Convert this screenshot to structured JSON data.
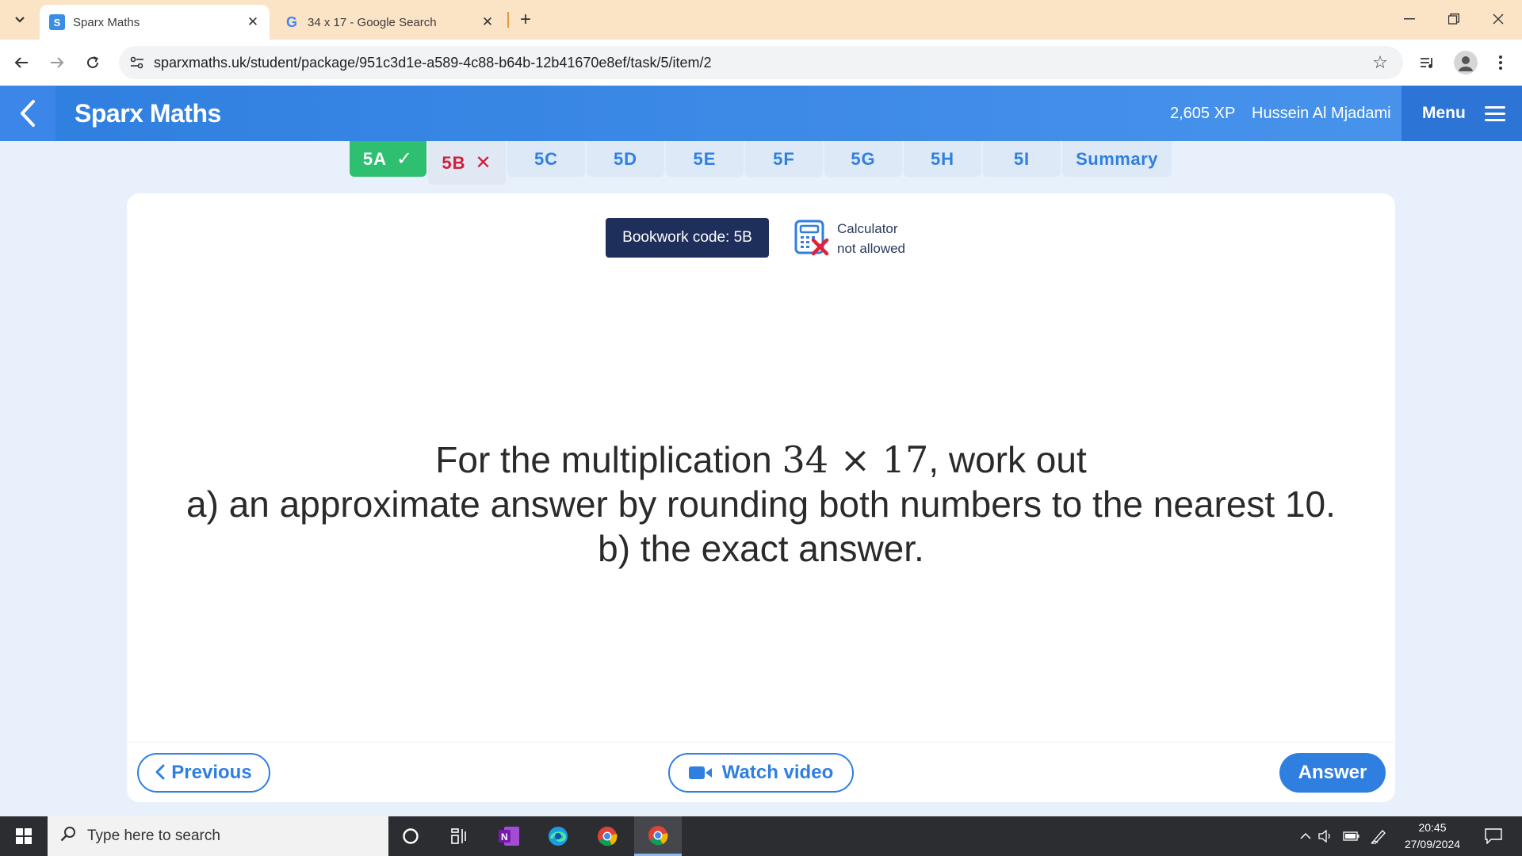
{
  "browser": {
    "tabs": [
      {
        "title": "Sparx Maths",
        "favicon": "S",
        "active": true
      },
      {
        "title": "34 x 17 - Google Search",
        "favicon": "G",
        "active": false
      }
    ],
    "url": "sparxmaths.uk/student/package/951c3d1e-a589-4c88-b64b-12b41670e8ef/task/5/item/2"
  },
  "app": {
    "title": "Sparx Maths",
    "xp": "2,605 XP",
    "user": "Hussein Al Mjadami",
    "menu_label": "Menu"
  },
  "tasks": [
    {
      "label": "5A",
      "status": "correct",
      "mark": "✓"
    },
    {
      "label": "5B",
      "status": "wrong",
      "mark": "✕"
    },
    {
      "label": "5C"
    },
    {
      "label": "5D"
    },
    {
      "label": "5E"
    },
    {
      "label": "5F"
    },
    {
      "label": "5G"
    },
    {
      "label": "5H"
    },
    {
      "label": "5I"
    },
    {
      "label": "Summary"
    }
  ],
  "card": {
    "bookwork": "Bookwork code: 5B",
    "calculator_line1": "Calculator",
    "calculator_line2": "not allowed",
    "question": {
      "line1_pre": "For the multiplication ",
      "line1_math": "34 × 17",
      "line1_post": ", work out",
      "line2": "a) an approximate answer by rounding both numbers to the nearest 10.",
      "line3": "b) the exact answer."
    },
    "prev_label": "Previous",
    "video_label": "Watch video",
    "answer_label": "Answer"
  },
  "taskbar": {
    "search_placeholder": "Type here to search",
    "time": "20:45",
    "date": "27/09/2024"
  },
  "colors": {
    "accent": "#2f7fe0",
    "correct": "#2fbf71",
    "wrong": "#d11f3a",
    "bookwork_bg": "#1f2f5c"
  }
}
